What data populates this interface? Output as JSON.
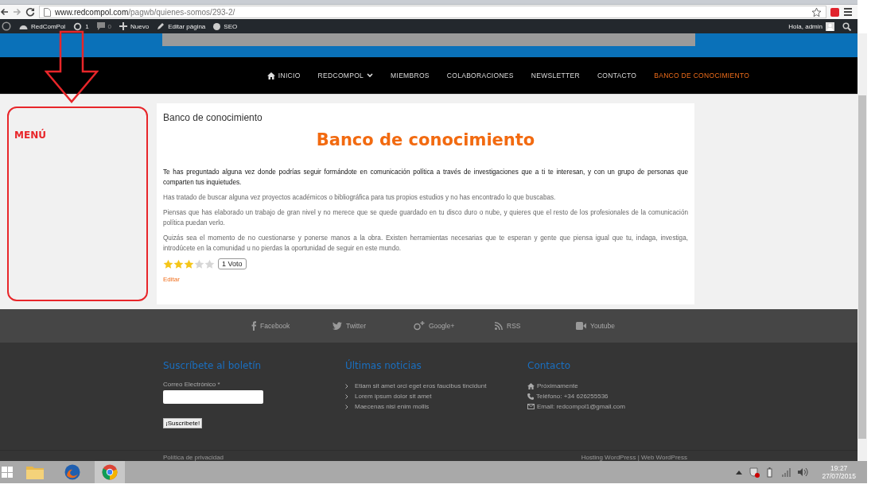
{
  "browser": {
    "url_host": "www.redcompol.com",
    "url_path": "/pagwb/quienes-somos/293-2/"
  },
  "admin_bar": {
    "items": [
      {
        "kind": "site",
        "label": "RedComPol"
      },
      {
        "kind": "updates",
        "label": "1"
      },
      {
        "kind": "comments",
        "label": "0"
      },
      {
        "kind": "new",
        "label": "Nuevo"
      },
      {
        "kind": "edit",
        "label": "Editar página"
      },
      {
        "kind": "seo",
        "label": "SEO"
      }
    ],
    "greeting": "Hola, admin"
  },
  "nav": [
    {
      "kind": "home",
      "label": "INICIO",
      "selected": false
    },
    {
      "kind": "dropdown",
      "label": "REDCOMPOL",
      "selected": false
    },
    {
      "kind": "plain",
      "label": "MIEMBROS",
      "selected": false
    },
    {
      "kind": "plain",
      "label": "COLABORACIONES",
      "selected": false
    },
    {
      "kind": "plain",
      "label": "NEWSLETTER",
      "selected": false
    },
    {
      "kind": "plain",
      "label": "CONTACTO",
      "selected": false
    },
    {
      "kind": "plain",
      "label": "BANCO DE CONOCIMIENTO",
      "selected": true
    }
  ],
  "annotation": {
    "label": "MENÚ"
  },
  "article": {
    "breadcrumb": "Banco de conocimiento",
    "heading": "Banco de conocimiento",
    "paragraphs": [
      {
        "strong": true,
        "text": "Te has preguntado alguna vez donde podrías seguir formándote en comunicación política a través de investigaciones que a ti te interesan, y con  un grupo de personas que comparten tus inquietudes."
      },
      {
        "strong": false,
        "text": "Has tratado de buscar alguna vez proyectos académicos o bibliográfica para tus propios estudios y no has encontrado lo que buscabas."
      },
      {
        "strong": false,
        "text": "Piensas que has elaborado un trabajo de gran nivel y no merece que se quede guardado en tu disco duro o nube, y quieres que el resto de los profesionales de la comunicación política puedan verlo."
      },
      {
        "strong": false,
        "text": "Quizás sea el momento de no cuestionarse y ponerse manos a la obra. Existen herramientas necesarias que te esperan y gente que piensa igual que tu, indaga, investiga, introdúcete en la comunidad u no pierdas la oportunidad de seguir en este mundo."
      }
    ],
    "rating": {
      "stars": 3,
      "votes": "1 Voto"
    },
    "edit_link": "Editar"
  },
  "social": [
    {
      "kind": "facebook",
      "label": "Facebook"
    },
    {
      "kind": "twitter",
      "label": "Twitter"
    },
    {
      "kind": "google",
      "label": "Google+"
    },
    {
      "kind": "rss",
      "label": "RSS"
    },
    {
      "kind": "youtube",
      "label": "Youtube"
    }
  ],
  "footer": {
    "newsletter": {
      "title": "Suscríbete al boletín",
      "field_label": "Correo Electrónico *",
      "button": "¡Suscríbete!"
    },
    "news": {
      "title": "Últimas noticias",
      "items": [
        "Etiam sit amet orci eget eros faucibus tincidunt",
        "Lorem ipsum dolor sit amet",
        "Maecenas nisi enim mollis"
      ]
    },
    "contact": {
      "title": "Contacto",
      "items": [
        {
          "kind": "home",
          "text": "Próximamente"
        },
        {
          "kind": "phone",
          "text": "Teléfono: +34 626255536"
        },
        {
          "kind": "mail",
          "text": "Email: redcompol1@gmail.com"
        }
      ]
    },
    "bottom_left": "Política de privacidad",
    "bottom_right": "Hosting WordPress | Web WordPress"
  },
  "taskbar": {
    "time": "19:27",
    "date": "27/07/2015"
  }
}
